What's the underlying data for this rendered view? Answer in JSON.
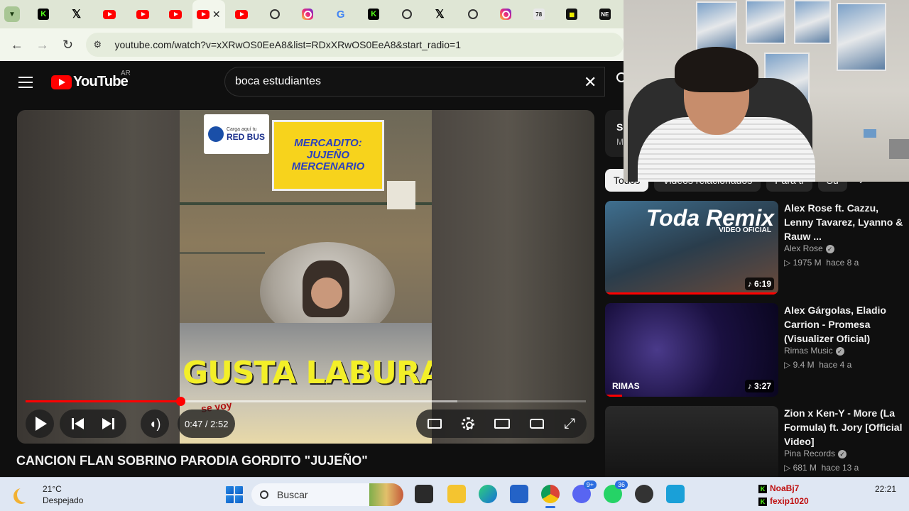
{
  "browser": {
    "url": "youtube.com/watch?v=xXRwOS0EeA8&list=RDxXRwOS0EeA8&start_radio=1",
    "tabs": [
      {
        "icon": "kick-icon",
        "glyph": "K",
        "cls": "kick"
      },
      {
        "icon": "x-icon",
        "glyph": "𝕏",
        "cls": "x"
      },
      {
        "icon": "youtube-icon",
        "glyph": "",
        "cls": "yt"
      },
      {
        "icon": "youtube-icon",
        "glyph": "",
        "cls": "yt"
      },
      {
        "icon": "youtube-icon",
        "glyph": "",
        "cls": "yt"
      },
      {
        "icon": "youtube-icon",
        "glyph": "",
        "cls": "yt",
        "active": true
      },
      {
        "icon": "youtube-icon",
        "glyph": "",
        "cls": "yt"
      },
      {
        "icon": "chatgpt-icon",
        "glyph": "",
        "cls": "gpt"
      },
      {
        "icon": "instagram-icon",
        "glyph": "",
        "cls": "ig"
      },
      {
        "icon": "google-icon",
        "glyph": "G",
        "cls": "google"
      },
      {
        "icon": "kick-icon",
        "glyph": "K",
        "cls": "kick"
      },
      {
        "icon": "chrome-icon",
        "glyph": "",
        "cls": "chrome"
      },
      {
        "icon": "x-icon",
        "glyph": "𝕏",
        "cls": "x"
      },
      {
        "icon": "chrome-icon",
        "glyph": "",
        "cls": "chrome"
      },
      {
        "icon": "instagram-icon",
        "glyph": "",
        "cls": "ig"
      },
      {
        "icon": "numbers-icon",
        "glyph": "78",
        "cls": "num"
      },
      {
        "icon": "grid-icon",
        "glyph": "▦",
        "cls": "grid"
      },
      {
        "icon": "ne-icon",
        "glyph": "NE",
        "cls": "ne"
      }
    ]
  },
  "youtube": {
    "logo_text": "YouTube",
    "country": "AR",
    "search_value": "boca estudiantes"
  },
  "player": {
    "current_time": "0:47",
    "duration": "2:52",
    "time_display": "0:47 / 2:52",
    "played_fraction": 0.276,
    "buffered_fraction": 0.77,
    "caption_text": "GUSTA LABURAR",
    "sign_text": "MERCADITO: JUJEÑO MERCENARIO",
    "redbus_top": "Carga aquí tu",
    "redbus_text": "RED BUS",
    "sticker_text": "se voy"
  },
  "video": {
    "title": "CANCION FLAN SOBRINO PARODIA GORDITO \"JUJEÑO\""
  },
  "side_card": {
    "line1": "S",
    "line2": "M"
  },
  "chips": [
    "Todos",
    "Videos relacionados",
    "Para ti",
    "Su"
  ],
  "recommendations": [
    {
      "title": "Alex Rose ft. Cazzu, Lenny Tavarez, Lyanno & Rauw ...",
      "channel": "Alex Rose",
      "verified": true,
      "views": "1975 M",
      "age": "hace 8 a",
      "duration": "6:19",
      "thumb_text": "Toda Remix",
      "thumb_sub": "VIDEO OFICIAL",
      "watched_fraction": 1.0
    },
    {
      "title": "Alex Gárgolas, Eladio Carrion - Promesa (Visualizer Oficial)",
      "channel": "Rimas Music",
      "verified": true,
      "views": "9.4 M",
      "age": "hace 4 a",
      "duration": "3:27",
      "thumb_text": "RIMAS",
      "thumb_sub": "",
      "watched_fraction": 0.1
    },
    {
      "title": "Zion x Ken-Y - More (La Formula) ft. Jory [Official Video]",
      "channel": "Pina Records",
      "verified": true,
      "views": "681 M",
      "age": "hace 13 a",
      "duration": "",
      "thumb_text": "",
      "thumb_sub": "",
      "watched_fraction": 0
    }
  ],
  "taskbar": {
    "temperature": "21°C",
    "weather": "Despejado",
    "search_placeholder": "Buscar",
    "discord_badge": "9+",
    "whatsapp_badge": "36",
    "tray_user1": "NoaBj7",
    "tray_user2": "fexip1020",
    "time": "22:21"
  },
  "colors": {
    "accent": "#ff0000",
    "kick": "#53fc18",
    "chrome_tabstrip": "#dfe6d5"
  }
}
